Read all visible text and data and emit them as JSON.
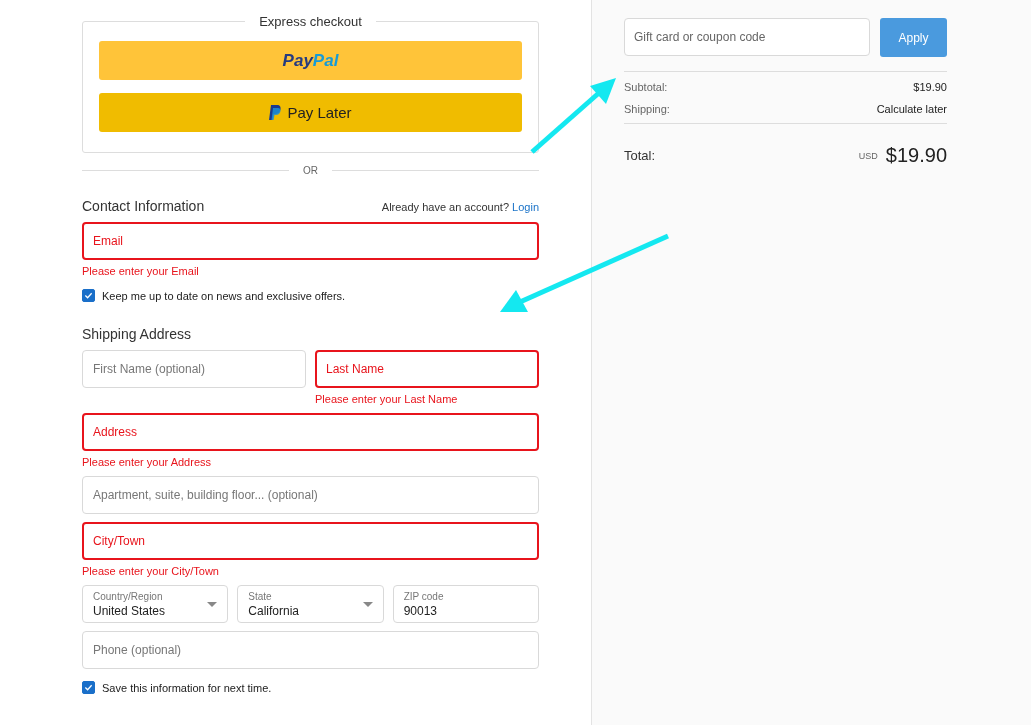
{
  "express_checkout": {
    "title": "Express checkout",
    "buttons": [
      {
        "kind": "paypal",
        "label_1": "Pay",
        "label_2": "Pal"
      },
      {
        "kind": "paylater",
        "label": "Pay Later"
      }
    ]
  },
  "divider_label": "OR",
  "contact": {
    "title": "Contact Information",
    "account_prompt": "Already have an account?",
    "login_link": "Login",
    "email": {
      "kind": "text",
      "placeholder": "Email",
      "error": true,
      "message": "Please enter your Email"
    },
    "newsletter": {
      "label": "Keep me up to date on news and exclusive offers.",
      "checked": true
    }
  },
  "shipping": {
    "title": "Shipping Address",
    "first_name": {
      "kind": "text",
      "placeholder": "First Name (optional)",
      "error": false
    },
    "last_name": {
      "kind": "text",
      "placeholder": "Last Name",
      "error": true,
      "message": "Please enter your Last Name"
    },
    "address": {
      "kind": "text",
      "placeholder": "Address",
      "error": true,
      "message": "Please enter your Address"
    },
    "apartment": {
      "kind": "text",
      "placeholder": "Apartment, suite, building floor... (optional)",
      "error": false
    },
    "city": {
      "kind": "text",
      "placeholder": "City/Town",
      "error": true,
      "message": "Please enter your City/Town"
    },
    "country": {
      "kind": "select",
      "label": "Country/Region",
      "value": "United States",
      "error": false
    },
    "state": {
      "kind": "select",
      "label": "State",
      "value": "California",
      "error": false
    },
    "zip": {
      "kind": "labeled",
      "label": "ZIP code",
      "value": "90013",
      "error": false
    },
    "phone": {
      "kind": "text",
      "placeholder": "Phone (optional)",
      "error": false
    },
    "save_info": {
      "label": "Save this information for next time.",
      "checked": true
    }
  },
  "summary": {
    "coupon": {
      "placeholder": "Gift card or coupon code",
      "button": "Apply"
    },
    "lines": [
      {
        "label": "Subtotal:",
        "value": "$19.90"
      },
      {
        "label": "Shipping:",
        "value": "Calculate later"
      }
    ],
    "total": {
      "label": "Total:",
      "currency": "USD",
      "amount": "$19.90"
    }
  }
}
